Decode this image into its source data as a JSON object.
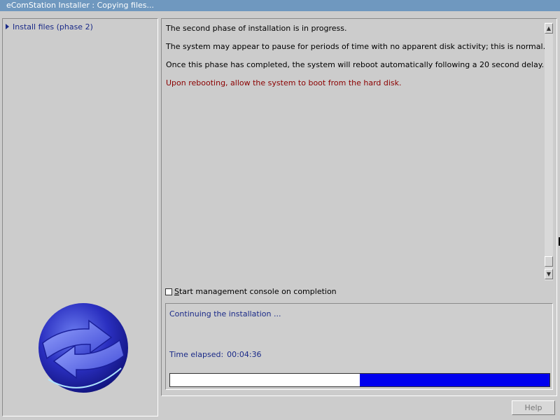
{
  "window": {
    "title": "eComStation Installer : Copying files..."
  },
  "sidebar": {
    "items": [
      {
        "label": "Install files (phase 2)"
      }
    ],
    "logo_icon": "ecomstation-globe-logo"
  },
  "content": {
    "messages": [
      "The second phase of installation is in progress.",
      "The system may appear to pause for periods of time with no apparent disk activity; this is normal.",
      "Once this phase has completed, the system will reboot automatically following a 20 second delay.",
      "Upon rebooting, allow the system to boot from the hard disk."
    ],
    "warning_color": "#8b0000"
  },
  "options": {
    "management_console": {
      "label_underlined": "S",
      "label_rest": "tart management console on completion",
      "checked": false
    }
  },
  "status": {
    "text": "Continuing the installation ...",
    "elapsed_label": "Time elapsed:",
    "elapsed_value": "00:04:36",
    "progress_fraction": 0.5,
    "progress_color": "#0000ee"
  },
  "buttons": {
    "help": "Help"
  },
  "colors": {
    "titlebar": "#6f98bf",
    "text_blue": "#1a2a88",
    "background": "#cccccc"
  }
}
